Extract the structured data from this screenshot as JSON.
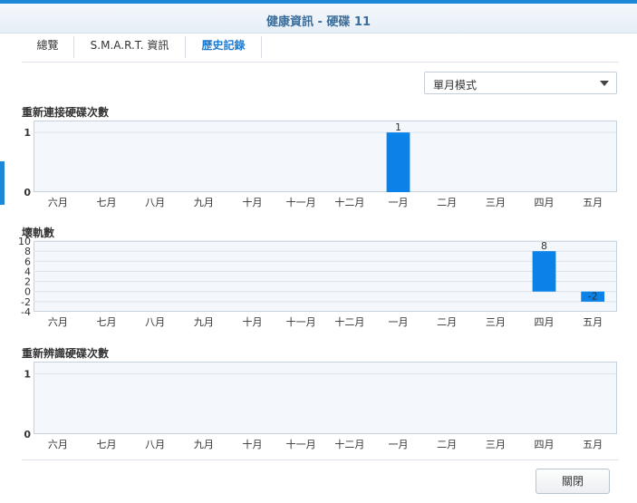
{
  "window": {
    "title": "健康資訊 - 硬碟 11"
  },
  "tabs": [
    {
      "label": "總覽",
      "active": false
    },
    {
      "label": "S.M.A.R.T. 資訊",
      "active": false
    },
    {
      "label": "歷史記錄",
      "active": true
    }
  ],
  "mode_select": {
    "value": "單月模式"
  },
  "colors": {
    "accent": "#1d87d8",
    "bar": "#0a82e8",
    "tab_active": "#1d7bd1"
  },
  "footer": {
    "close_label": "關閉"
  },
  "chart_data": [
    {
      "type": "bar",
      "title": "重新連接硬碟次數",
      "categories": [
        "六月",
        "七月",
        "八月",
        "九月",
        "十月",
        "十一月",
        "十二月",
        "一月",
        "二月",
        "三月",
        "四月",
        "五月"
      ],
      "values": [
        null,
        null,
        null,
        null,
        null,
        null,
        null,
        1,
        null,
        null,
        null,
        null
      ],
      "data_labels": [
        "",
        "",
        "",
        "",
        "",
        "",
        "",
        "1",
        "",
        "",
        "",
        ""
      ],
      "yticks": [
        0,
        1
      ],
      "ylim": [
        0,
        1.2
      ]
    },
    {
      "type": "bar",
      "title": "壞軌數",
      "categories": [
        "六月",
        "七月",
        "八月",
        "九月",
        "十月",
        "十一月",
        "十二月",
        "一月",
        "二月",
        "三月",
        "四月",
        "五月"
      ],
      "values": [
        null,
        null,
        null,
        null,
        null,
        null,
        null,
        null,
        null,
        null,
        8,
        -2
      ],
      "data_labels": [
        "",
        "",
        "",
        "",
        "",
        "",
        "",
        "",
        "",
        "",
        "8",
        "-2"
      ],
      "yticks": [
        10,
        8,
        6,
        4,
        2,
        0,
        -2,
        -4
      ],
      "ylim": [
        -4,
        10
      ]
    },
    {
      "type": "bar",
      "title": "重新辨識硬碟次數",
      "categories": [
        "六月",
        "七月",
        "八月",
        "九月",
        "十月",
        "十一月",
        "十二月",
        "一月",
        "二月",
        "三月",
        "四月",
        "五月"
      ],
      "values": [
        null,
        null,
        null,
        null,
        null,
        null,
        null,
        null,
        null,
        null,
        null,
        null
      ],
      "data_labels": [
        "",
        "",
        "",
        "",
        "",
        "",
        "",
        "",
        "",
        "",
        "",
        ""
      ],
      "yticks": [
        0,
        1
      ],
      "ylim": [
        0,
        1.2
      ]
    }
  ]
}
